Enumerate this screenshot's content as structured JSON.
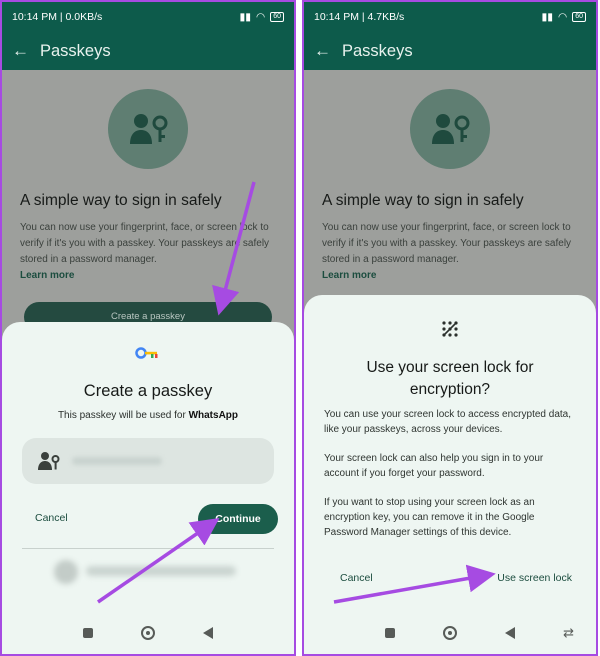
{
  "left": {
    "status": {
      "time": "10:14 PM | 0.0KB/s",
      "battery": "60"
    },
    "appbar": {
      "back": "←",
      "title": "Passkeys"
    },
    "content": {
      "headline": "A simple way to sign in safely",
      "description": "You can now use your fingerprint, face, or screen lock to verify if it's you with a passkey. Your passkeys are safely stored in a password manager.",
      "learn_more": "Learn more",
      "create_button": "Create a passkey"
    },
    "sheet": {
      "title": "Create a passkey",
      "subtitle_prefix": "This passkey will be used for ",
      "subtitle_app": "WhatsApp",
      "cancel": "Cancel",
      "continue": "Continue"
    }
  },
  "right": {
    "status": {
      "time": "10:14 PM | 4.7KB/s",
      "battery": "60"
    },
    "appbar": {
      "back": "←",
      "title": "Passkeys"
    },
    "content": {
      "headline": "A simple way to sign in safely",
      "description": "You can now use your fingerprint, face, or screen lock to verify if it's you with a passkey. Your passkeys are safely stored in a password manager.",
      "learn_more": "Learn more"
    },
    "sheet": {
      "title": "Use your screen lock for encryption?",
      "para1": "You can use your screen lock to access encrypted data, like your passkeys, across your devices.",
      "para2": "Your screen lock can also help you sign in to your account if you forget your password.",
      "para3": "If you want to stop using your screen lock as an encryption key, you can remove it in the Google Password Manager settings of this device.",
      "cancel": "Cancel",
      "use_screen_lock": "Use screen lock"
    }
  },
  "colors": {
    "header": "#0d5b4b",
    "accent": "#1b5e4c",
    "arrow": "#a64be2"
  }
}
